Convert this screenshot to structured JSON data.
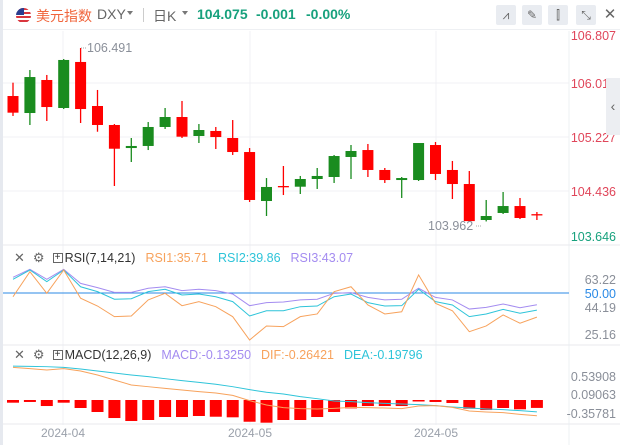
{
  "header": {
    "name": "美元指数",
    "code": "DXY",
    "period": "日K",
    "price": "104.075",
    "change": "-0.001",
    "change_pct": "-0.00%",
    "tools": [
      "indicator-icon",
      "draw-icon",
      "candle-type-icon",
      "shrink-icon",
      "close-icon"
    ],
    "tool_glyphs": [
      "⩘",
      "✎",
      "⫿",
      "⤡",
      "✕"
    ]
  },
  "colors": {
    "up": "#1a8c1f",
    "down": "#ff0000",
    "rsi1": "#f7a25c",
    "rsi2": "#2ec4d9",
    "rsi3": "#a48cf0",
    "rsi50": "#2b8ae6",
    "dif": "#f7a25c",
    "dea": "#2ec4d9",
    "axis_red": "#e0465a",
    "axis_green": "#17a17d"
  },
  "price_axis": [
    "106.807",
    "106.017",
    "105.227",
    "104.436",
    "103.646"
  ],
  "high_label": "106.491",
  "low_label": "103.962",
  "x_axis": [
    "2024-04",
    "2024-05",
    "2024-05"
  ],
  "rsi": {
    "title": "RSI(7,14,21)",
    "rsi1": "RSI1:35.71",
    "rsi2": "RSI2:39.86",
    "rsi3": "RSI3:43.07",
    "axis": [
      "63.22",
      "50.00",
      "44.19",
      "25.16"
    ]
  },
  "macd": {
    "title": "MACD(12,26,9)",
    "macd": "MACD:-0.13250",
    "dif": "DIF:-0.26421",
    "dea": "DEA:-0.19796",
    "axis": [
      "0.53908",
      "0.09063",
      "-0.35781"
    ]
  },
  "chart_data": {
    "type": "candlestick",
    "candles": [
      {
        "o": 105.793,
        "h": 105.987,
        "l": 105.503,
        "c": 105.551
      },
      {
        "o": 105.546,
        "h": 106.171,
        "l": 105.372,
        "c": 106.069
      },
      {
        "o": 106.026,
        "h": 106.099,
        "l": 105.43,
        "c": 105.633
      },
      {
        "o": 105.619,
        "h": 106.331,
        "l": 105.604,
        "c": 106.317
      },
      {
        "o": 106.288,
        "h": 106.491,
        "l": 105.401,
        "c": 105.604
      },
      {
        "o": 105.648,
        "h": 105.881,
        "l": 105.274,
        "c": 105.372
      },
      {
        "o": 105.372,
        "h": 105.386,
        "l": 104.485,
        "c": 105.027
      },
      {
        "o": 105.037,
        "h": 105.183,
        "l": 104.834,
        "c": 105.067
      },
      {
        "o": 105.067,
        "h": 105.415,
        "l": 105.008,
        "c": 105.343
      },
      {
        "o": 105.343,
        "h": 105.619,
        "l": 105.314,
        "c": 105.488
      },
      {
        "o": 105.488,
        "h": 105.721,
        "l": 105.183,
        "c": 105.202
      },
      {
        "o": 105.212,
        "h": 105.386,
        "l": 105.11,
        "c": 105.299
      },
      {
        "o": 105.285,
        "h": 105.343,
        "l": 105.023,
        "c": 105.197
      },
      {
        "o": 105.183,
        "h": 105.444,
        "l": 104.936,
        "c": 104.979
      },
      {
        "o": 104.979,
        "h": 105.037,
        "l": 104.253,
        "c": 104.282
      },
      {
        "o": 104.267,
        "h": 104.601,
        "l": 104.049,
        "c": 104.471
      },
      {
        "o": 104.485,
        "h": 104.776,
        "l": 104.354,
        "c": 104.471
      },
      {
        "o": 104.475,
        "h": 104.631,
        "l": 104.369,
        "c": 104.587
      },
      {
        "o": 104.587,
        "h": 104.747,
        "l": 104.442,
        "c": 104.631
      },
      {
        "o": 104.616,
        "h": 104.936,
        "l": 104.529,
        "c": 104.921
      },
      {
        "o": 104.907,
        "h": 105.081,
        "l": 104.587,
        "c": 104.994
      },
      {
        "o": 105.008,
        "h": 105.096,
        "l": 104.616,
        "c": 104.718
      },
      {
        "o": 104.718,
        "h": 104.747,
        "l": 104.529,
        "c": 104.572
      },
      {
        "o": 104.572,
        "h": 104.616,
        "l": 104.311,
        "c": 104.601
      },
      {
        "o": 104.572,
        "h": 105.11,
        "l": 104.558,
        "c": 105.11
      },
      {
        "o": 105.081,
        "h": 105.125,
        "l": 104.572,
        "c": 104.66
      },
      {
        "o": 104.718,
        "h": 104.849,
        "l": 104.296,
        "c": 104.514
      },
      {
        "o": 104.514,
        "h": 104.703,
        "l": 103.962,
        "c": 103.975
      },
      {
        "o": 103.991,
        "h": 104.282,
        "l": 103.97,
        "c": 104.049
      },
      {
        "o": 104.093,
        "h": 104.398,
        "l": 104.078,
        "c": 104.194
      },
      {
        "o": 104.194,
        "h": 104.311,
        "l": 104.005,
        "c": 104.02
      },
      {
        "o": 104.076,
        "h": 104.107,
        "l": 103.991,
        "c": 104.075
      }
    ],
    "rsi1": [
      47.8,
      62.6,
      49.8,
      63.6,
      46.9,
      42.3,
      36.0,
      36.4,
      45.9,
      49.8,
      42.5,
      44.9,
      41.9,
      36.0,
      22.2,
      30.5,
      30.1,
      36.0,
      37.6,
      50.8,
      53.7,
      42.9,
      37.6,
      38.9,
      60.7,
      43.9,
      39.5,
      27.1,
      30.5,
      37.0,
      32.1,
      35.71
    ],
    "rsi2": [
      58.1,
      63.6,
      56.7,
      63.6,
      53.7,
      50.8,
      46.3,
      46.6,
      50.8,
      52.2,
      48.8,
      49.4,
      47.8,
      44.9,
      36.4,
      39.5,
      39.5,
      41.9,
      42.3,
      47.8,
      49.4,
      44.3,
      42.3,
      42.5,
      52.2,
      44.9,
      42.9,
      36.0,
      37.6,
      40.3,
      38.0,
      39.86
    ],
    "rsi3": [
      59.3,
      64.0,
      58.1,
      64.0,
      55.7,
      53.2,
      50.4,
      50.4,
      52.8,
      53.7,
      51.4,
      52.2,
      51.4,
      49.4,
      42.5,
      44.3,
      44.7,
      45.9,
      46.3,
      49.8,
      50.2,
      47.4,
      45.9,
      46.3,
      52.8,
      47.4,
      45.9,
      40.5,
      41.5,
      43.5,
      41.3,
      43.07
    ],
    "dif": [
      0.547,
      0.525,
      0.502,
      0.525,
      0.486,
      0.419,
      0.335,
      0.251,
      0.223,
      0.195,
      0.167,
      0.14,
      0.117,
      0.078,
      -0.011,
      -0.084,
      -0.128,
      -0.145,
      -0.151,
      -0.14,
      -0.123,
      -0.128,
      -0.134,
      -0.145,
      -0.1,
      -0.095,
      -0.123,
      -0.184,
      -0.201,
      -0.212,
      -0.24,
      -0.264
    ],
    "dea": [
      0.567,
      0.564,
      0.558,
      0.547,
      0.519,
      0.486,
      0.452,
      0.419,
      0.391,
      0.357,
      0.324,
      0.296,
      0.263,
      0.223,
      0.173,
      0.129,
      0.101,
      0.056,
      0.022,
      -0.017,
      -0.028,
      -0.045,
      -0.056,
      -0.067,
      -0.078,
      -0.095,
      -0.117,
      -0.134,
      -0.151,
      -0.162,
      -0.179,
      -0.198
    ],
    "macd_hist": [
      -0.045,
      -0.033,
      -0.101,
      -0.045,
      -0.134,
      -0.201,
      -0.302,
      -0.352,
      -0.335,
      -0.285,
      -0.285,
      -0.268,
      -0.28,
      -0.29,
      -0.364,
      -0.38,
      -0.335,
      -0.335,
      -0.285,
      -0.201,
      -0.14,
      -0.101,
      -0.101,
      -0.101,
      -0.022,
      -0.033,
      -0.05,
      -0.146,
      -0.168,
      -0.134,
      -0.156,
      -0.1325
    ],
    "price_range": [
      103.646,
      106.807
    ]
  }
}
